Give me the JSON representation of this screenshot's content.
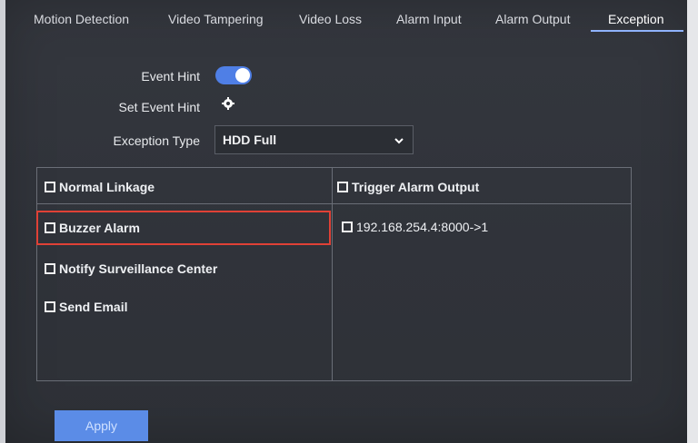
{
  "tabs": [
    {
      "label": "Motion Detection"
    },
    {
      "label": "Video Tampering"
    },
    {
      "label": "Video Loss"
    },
    {
      "label": "Alarm Input"
    },
    {
      "label": "Alarm Output"
    },
    {
      "label": "Exception",
      "active": true
    }
  ],
  "form": {
    "event_hint_label": "Event Hint",
    "event_hint_enabled": true,
    "set_event_hint_label": "Set Event Hint",
    "exception_type_label": "Exception Type",
    "exception_type_value": "HDD Full"
  },
  "linkage": {
    "normal_header": "Normal Linkage",
    "trigger_header": "Trigger Alarm Output",
    "normal_items": [
      "Buzzer Alarm",
      "Notify Surveillance Center",
      "Send Email"
    ],
    "trigger_items": [
      "192.168.254.4:8000->1"
    ]
  },
  "actions": {
    "apply_label": "Apply"
  },
  "colors": {
    "accent": "#4f7fe6",
    "highlight": "#e04136"
  }
}
